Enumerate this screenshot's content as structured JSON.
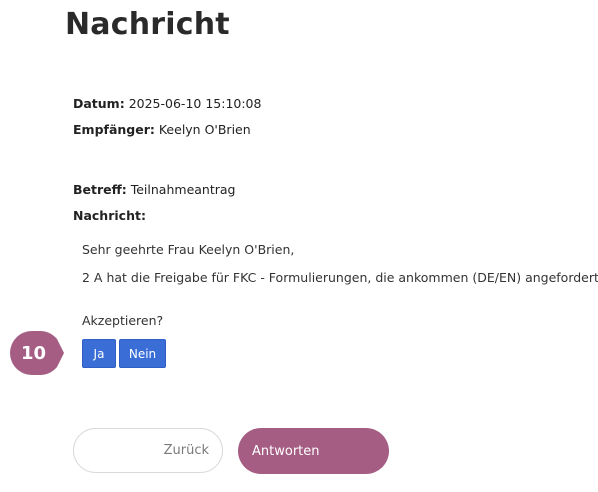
{
  "page": {
    "title": "Nachricht"
  },
  "meta": {
    "date_label": "Datum:",
    "date_value": "2025-06-10 15:10:08",
    "recipient_label": "Empfänger:",
    "recipient_value": "Keelyn O'Brien",
    "subject_label": "Betreff:",
    "subject_value": "Teilnahmeantrag",
    "message_label": "Nachricht:"
  },
  "message": {
    "greeting": "Sehr geehrte Frau Keelyn O'Brien,",
    "body": "2 A hat die Freigabe für FKC - Formulierungen, die ankommen (DE/EN) angefordert",
    "question": "Akzeptieren?"
  },
  "actions": {
    "yes_label": "Ja",
    "no_label": "Nein",
    "back_label": "Zurück",
    "reply_label": "Antworten"
  },
  "step_badge": {
    "number": "10",
    "color": "#a55d84"
  },
  "colors": {
    "primary_button": "#3a6ed6",
    "accent": "#a55d84"
  }
}
